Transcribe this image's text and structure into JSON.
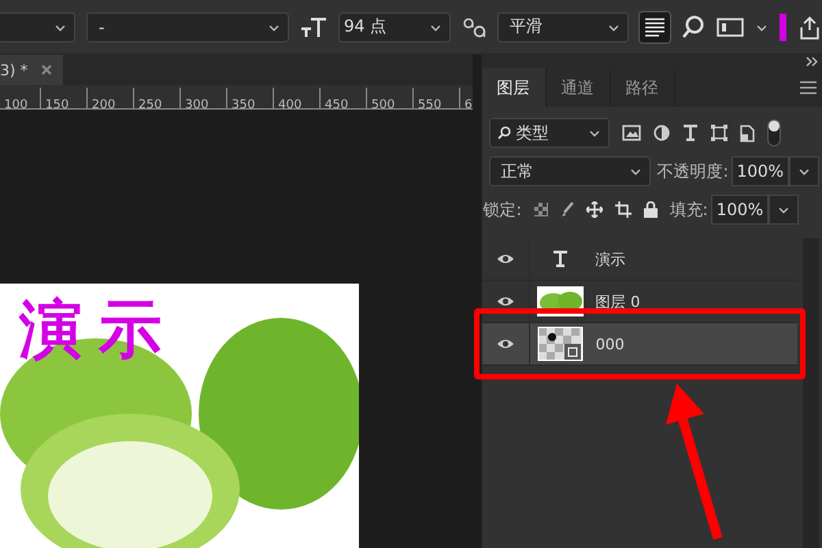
{
  "options_bar": {
    "font_style": "-",
    "font_size": "94 点",
    "antialias": "平滑",
    "align_left_selected": true
  },
  "document_tab": {
    "title": "3) *"
  },
  "ruler": {
    "labels": [
      "100",
      "150",
      "200",
      "250",
      "300",
      "350",
      "400",
      "450",
      "500",
      "550",
      "6"
    ]
  },
  "canvas": {
    "text": "演示"
  },
  "panel": {
    "tabs": [
      {
        "label": "图层",
        "selected": true
      },
      {
        "label": "通道",
        "selected": false
      },
      {
        "label": "路径",
        "selected": false
      }
    ],
    "filter": {
      "value": "类型"
    },
    "blend_mode": "正常",
    "opacity_label": "不透明度:",
    "opacity": "100%",
    "lock_label": "锁定:",
    "fill_label": "填充:",
    "fill": "100%",
    "layers": [
      {
        "kind": "text",
        "name": "演示",
        "visible": true,
        "selected": false
      },
      {
        "kind": "image",
        "name": "图层 0",
        "visible": true,
        "selected": false
      },
      {
        "kind": "smart",
        "name": "000",
        "visible": true,
        "selected": true
      }
    ]
  }
}
